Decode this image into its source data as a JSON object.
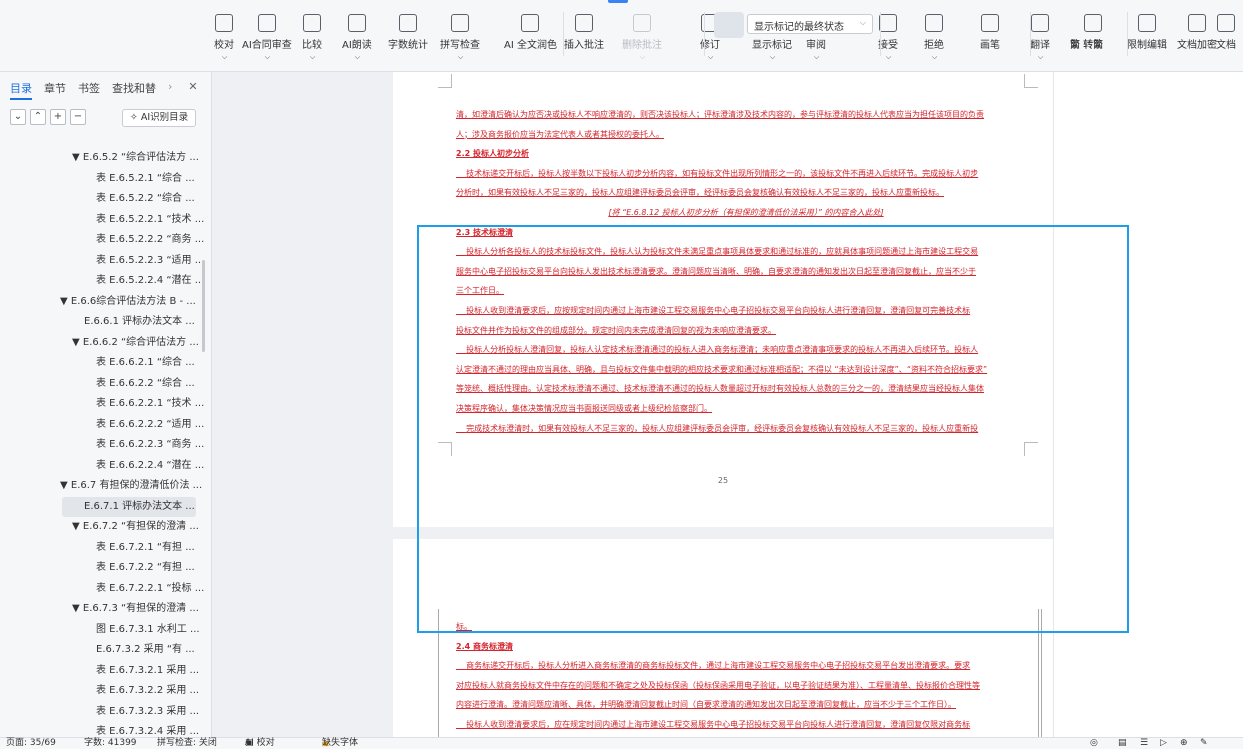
{
  "ribbon": {
    "tools": [
      {
        "id": "proofread",
        "label": "校对",
        "caret": true
      },
      {
        "id": "ai-contract",
        "label": "AI合同审查",
        "caret": true
      },
      {
        "id": "compare",
        "label": "比较",
        "caret": true
      },
      {
        "id": "ai-read",
        "label": "AI朗读",
        "caret": true
      },
      {
        "id": "wordcount",
        "label": "字数统计"
      },
      {
        "id": "spellcheck",
        "label": "拼写检查",
        "caret": true
      },
      {
        "id": "ai-polish",
        "label": "AI 全文润色"
      },
      {
        "id": "insert-comment",
        "label": "插入批注"
      },
      {
        "id": "delete-comment",
        "label": "删除批注",
        "caret": true
      },
      {
        "id": "revise",
        "label": "修订",
        "caret": true
      },
      {
        "id": "show-markup",
        "label": "显示标记",
        "caret": true
      },
      {
        "id": "review-pane",
        "label": "审阅",
        "caret": true
      },
      {
        "id": "accept",
        "label": "接受",
        "caret": true
      },
      {
        "id": "reject",
        "label": "拒绝",
        "caret": true
      },
      {
        "id": "pen",
        "label": "画笔"
      },
      {
        "id": "translate",
        "label": "翻译",
        "caret": true
      },
      {
        "id": "to-trad",
        "label": "简 转繁"
      },
      {
        "id": "to-simp",
        "label": "繁 转简"
      },
      {
        "id": "restrict",
        "label": "限制编辑"
      },
      {
        "id": "encrypt",
        "label": "文档加密"
      },
      {
        "id": "more",
        "label": "文档"
      }
    ],
    "markup_dropdown": "显示标记的最终状态"
  },
  "left_panel": {
    "tabs": [
      "目录",
      "章节",
      "书签",
      "查找和替"
    ],
    "ai_outline_button": "AI识别目录",
    "tree": [
      {
        "label": "▼ E.6.5.2 “综合评估法方 ...",
        "indent": 1
      },
      {
        "label": "表 E.6.5.2.1 “综合 ...",
        "indent": 3
      },
      {
        "label": "表 E.6.5.2.2 “综合 ...",
        "indent": 3
      },
      {
        "label": "表 E.6.5.2.2.1 “技术 ...",
        "indent": 3
      },
      {
        "label": "表 E.6.5.2.2.2 “商务 ...",
        "indent": 3
      },
      {
        "label": "表 E.6.5.2.2.3 “适用 ...",
        "indent": 3
      },
      {
        "label": "表 E.6.5.2.2.4 “潜在 ...",
        "indent": 3
      },
      {
        "label": "▼ E.6.6综合评估法方法 B - ...",
        "indent": 0
      },
      {
        "label": "E.6.6.1 评标办法文本 ...",
        "indent": 2
      },
      {
        "label": "▼ E.6.6.2 “综合评估法方 ...",
        "indent": 1
      },
      {
        "label": "表 E.6.6.2.1 “综合 ...",
        "indent": 3
      },
      {
        "label": "表 E.6.6.2.2 “综合 ...",
        "indent": 3
      },
      {
        "label": "表 E.6.6.2.2.1 “技术 ...",
        "indent": 3
      },
      {
        "label": "表 E.6.6.2.2.2 “适用 ...",
        "indent": 3
      },
      {
        "label": "表 E.6.6.2.2.3 “商务 ...",
        "indent": 3
      },
      {
        "label": "表 E.6.6.2.2.4 “潜在 ...",
        "indent": 3
      },
      {
        "label": "▼ E.6.7 有担保的澄清低价法 ...",
        "indent": 0
      },
      {
        "label": "E.6.7.1 评标办法文本 ...",
        "indent": 2,
        "selected": true
      },
      {
        "label": "▼ E.6.7.2 “有担保的澄清 ...",
        "indent": 1
      },
      {
        "label": "表 E.6.7.2.1 “有担 ...",
        "indent": 3
      },
      {
        "label": "表 E.6.7.2.2 “有担 ...",
        "indent": 3
      },
      {
        "label": "表 E.6.7.2.2.1 “投标 ...",
        "indent": 3
      },
      {
        "label": "▼ E.6.7.3 “有担保的澄清 ...",
        "indent": 1
      },
      {
        "label": "图 E.6.7.3.1 水利工 ...",
        "indent": 3
      },
      {
        "label": "E.6.7.3.2 采用 “有 ...",
        "indent": 3
      },
      {
        "label": "表 E.6.7.3.2.1 采用 ...",
        "indent": 3
      },
      {
        "label": "表 E.6.7.3.2.2 采用 ...",
        "indent": 3
      },
      {
        "label": "表 E.6.7.3.2.3 采用 ...",
        "indent": 3
      },
      {
        "label": "表 E.6.7.3.2.4 采用 ...",
        "indent": 3
      }
    ]
  },
  "document": {
    "page1_lines": [
      {
        "text": "清，如澄清后确认为应否决或投标人不响应澄清的，则否决该投标人；评标澄清涉及技术内容的，参与评标澄清的投标人代表应当为担任该项目的负责",
        "style": ""
      },
      {
        "text": "人；涉及商务报价应当为法定代表人或者其授权的委托人。",
        "style": ""
      },
      {
        "text": "2.2 投标人初步分析",
        "style": "heading"
      },
      {
        "text": "    技术标递交开标后，投标人按半数以下投标人初步分析内容，如有投标文件出现所列情形之一的，该投标文件不再进入后续环节。完成投标人初步",
        "style": ""
      },
      {
        "text": "分析时，如果有效投标人不足三家的，投标人应组建评标委员会评审，经评标委员会复核确认有效投标人不足三家的，投标人应重新投标。",
        "style": ""
      },
      {
        "text": "[将 “E.6.8.12 投标人初步分析（有担保的澄清低价法采用）” 的内容合入此处]",
        "style": "center"
      },
      {
        "text": "2.3 技术标澄清",
        "style": "heading"
      },
      {
        "text": "    投标人分析各投标人的技术标投标文件，投标人认为投标文件未满足重点事项具体要求和通过标准的，应就具体事项问题通过上海市建设工程交易",
        "style": ""
      },
      {
        "text": "服务中心电子招投标交易平台向投标人发出技术标澄清要求。澄清问题应当清晰、明确，自要求澄清的通知发出次日起至澄清回复截止，应当不少于",
        "style": ""
      },
      {
        "text": "三个工作日。",
        "style": ""
      },
      {
        "text": "    投标人收到澄清要求后，应按规定时间内通过上海市建设工程交易服务中心电子招投标交易平台向投标人进行澄清回复，澄清回复可完善技术标",
        "style": ""
      },
      {
        "text": "投标文件并作为投标文件的组成部分。规定时间内未完成澄清回复的视为未响应澄清要求。",
        "style": ""
      },
      {
        "text": "    投标人分析投标人澄清回复，投标人认定技术标澄清通过的投标人进入商务标澄清；未响应重点澄清事项要求的投标人不再进入后续环节。投标人",
        "style": ""
      },
      {
        "text": "认定澄清不通过的理由应当具体、明确，且与投标文件集中载明的相应技术要求和通过标准相适配；不得以 “未达到设计深度”、“资料不符合招标要求”",
        "style": ""
      },
      {
        "text": "等笼统、概括性理由。认定技术标澄清不通过、技术标澄清不通过的投标人数量超过开标时有效投标人总数的三分之一的，澄清结果应当经投标人集体",
        "style": ""
      },
      {
        "text": "决策程序确认，集体决策情况应当书面报送同级或者上级纪检监察部门。",
        "style": ""
      },
      {
        "text": "    完成技术标澄清时，如果有效投标人不足三家的，投标人应组建评标委员会评审，经评标委员会复核确认有效投标人不足三家的，投标人应重新投",
        "style": ""
      }
    ],
    "page1_number": "25",
    "page2_lines": [
      {
        "text": "标。",
        "style": ""
      },
      {
        "text": "2.4 商务标澄清",
        "style": "heading"
      },
      {
        "text": "    商务标递交开标后，投标人分析进入商务标澄清的商务标投标文件，通过上海市建设工程交易服务中心电子招投标交易平台发出澄清要求。要求",
        "style": ""
      },
      {
        "text": "对应投标人就商务投标文件中存在的问题和不确定之处及投标保函（投标保函采用电子验证，以电子验证结果为准）、工程量清单、投标报价合理性等",
        "style": ""
      },
      {
        "text": "内容进行澄清。澄清问题应清晰、具体，并明确澄清回复截止时间（自要求澄清的通知发出次日起至澄清回复截止，应当不少于三个工作日）。",
        "style": ""
      },
      {
        "text": "    投标人收到澄清要求后，应在规定时间内通过上海市建设工程交易服务中心电子招投标交易平台向投标人进行澄清回复，澄清回复仅限对商务标",
        "style": ""
      }
    ]
  },
  "status": {
    "page": "页面: 35/69",
    "words": "字数: 41399",
    "spell": "拼写检查: 关闭",
    "ai_proof": "AI 校对",
    "missing_font": "缺失字体"
  }
}
